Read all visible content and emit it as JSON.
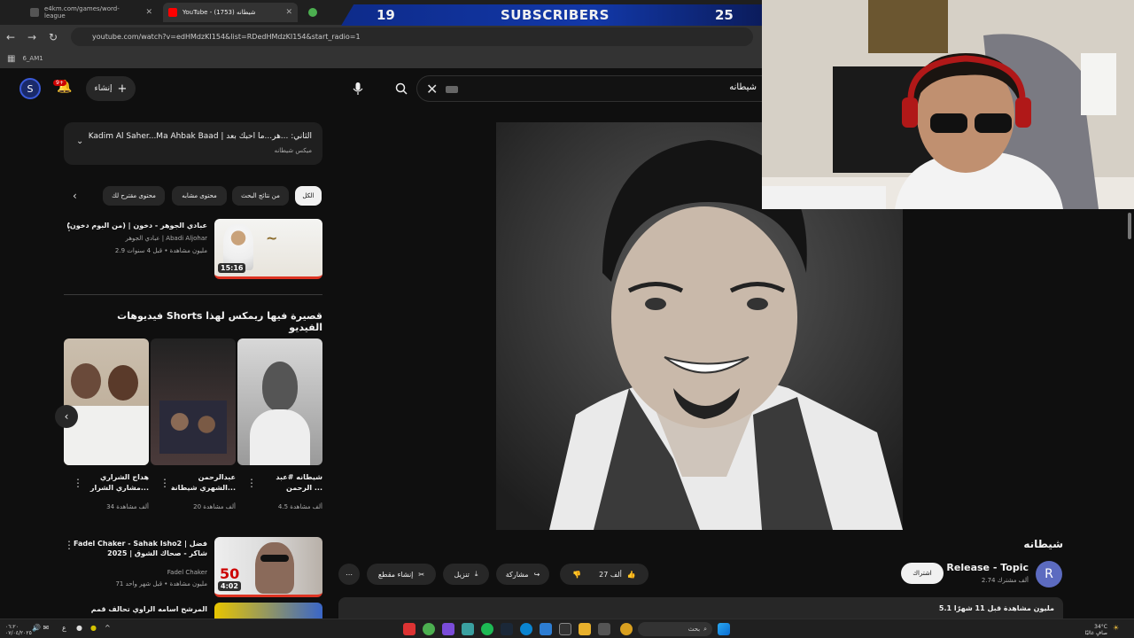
{
  "browser": {
    "tabs": [
      {
        "title": "e4km.com/games/word-league",
        "active": false
      },
      {
        "title": "YouTube - شيطانه (1753)",
        "active": true
      }
    ],
    "url": "youtube.com/watch?v=edHMdzKI154&list=RDedHMdzKI154&start_radio=1",
    "bookmark": "6_AM1"
  },
  "stream_overlay": {
    "left_count": "19",
    "label": "SUBSCRIBERS",
    "right_count": "25"
  },
  "youtube": {
    "search_query": "شيطانه",
    "create_label": "إنشاء",
    "notification_badge": "9+",
    "mix": {
      "title": "Kadim Al Saher...Ma Ahbak Baad | الثاني: ...هر...ما احبك بعد",
      "subtitle": "ميكس شيطانه"
    },
    "chips": [
      "الكل",
      "من نتائج البحث",
      "محتوى مشابه",
      "محتوى مقترح لك"
    ],
    "related": [
      {
        "title": "عبادي الجوهر - دخون | (من البوم دخون)",
        "channel": "عبادي الجوهر | Abadi Aljohar",
        "meta": "2.9 مليون مشاهدة • قبل 4 سنوات",
        "duration": "15:16"
      },
      {
        "title": "Fadel Chaker - Sahak Isho2 | فضل شاكر - صحاك الشوق | 2025",
        "channel": "Fadel Chaker",
        "meta": "71 مليون مشاهدة • قبل شهر واحد",
        "duration": "4:02"
      },
      {
        "title": "المرشح اسامه الراوي تحالف قمم"
      }
    ],
    "shorts_heading": "فيديوهات Shorts قصيرة فيها ريمكس لهذا الفيديو",
    "shorts": [
      {
        "title": "شيطانه #عبد الرحمن ...",
        "views": "4.5 ألف مشاهدة"
      },
      {
        "title": "عبدالرحمن الشهري شيطانة...",
        "views": "20 ألف مشاهدة"
      },
      {
        "title": "هداج الشراري مشاري الشرار...",
        "views": "34 ألف مشاهدة"
      }
    ],
    "video": {
      "title": "شيطانه",
      "channel": "Release - Topic",
      "channel_initial": "R",
      "subscribers": "2.74 ألف مشترك",
      "subscribe_label": "اشتراك",
      "likes": "27 ألف",
      "share_label": "مشاركة",
      "download_label": "تنزيل",
      "clip_label": "إنشاء مقطع",
      "views_line": "5.1 مليون مشاهدة  قبل 11 شهرًا"
    }
  },
  "taskbar": {
    "search_placeholder": "بحث",
    "weather": "34°C",
    "weather_desc": "صافٍ غالبًا",
    "lang": "ع",
    "time": "٠٦:٢٠",
    "date": "٠٧/٠٤/٢٠٢٥"
  },
  "colors": {
    "bg": "#0f0f0f",
    "surface": "#272727",
    "banner": "#1238a8",
    "youtube_red": "#ff0000"
  }
}
